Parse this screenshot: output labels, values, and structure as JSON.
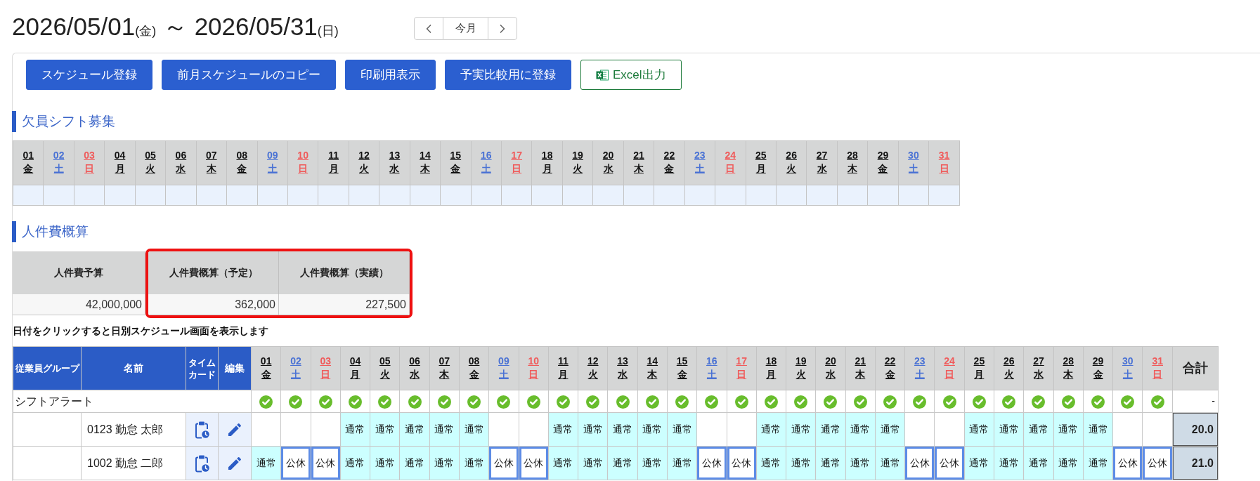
{
  "header": {
    "start_date": "2026/05/01",
    "start_weekday": "(金)",
    "separator": "～",
    "end_date": "2026/05/31",
    "end_weekday": "(日)",
    "nav": {
      "current_label": "今月"
    }
  },
  "toolbar": [
    {
      "label": "スケジュール登録",
      "kind": "primary"
    },
    {
      "label": "前月スケジュールのコピー",
      "kind": "primary"
    },
    {
      "label": "印刷用表示",
      "kind": "primary"
    },
    {
      "label": "予実比較用に登録",
      "kind": "primary"
    },
    {
      "label": "Excel出力",
      "kind": "excel"
    }
  ],
  "vacancy": {
    "heading": "欠員シフト募集",
    "days": [
      {
        "day": "01",
        "weekday": "金",
        "kind": "weekday"
      },
      {
        "day": "02",
        "weekday": "土",
        "kind": "saturday"
      },
      {
        "day": "03",
        "weekday": "日",
        "kind": "sunday"
      },
      {
        "day": "04",
        "weekday": "月",
        "kind": "weekday"
      },
      {
        "day": "05",
        "weekday": "火",
        "kind": "weekday"
      },
      {
        "day": "06",
        "weekday": "水",
        "kind": "weekday"
      },
      {
        "day": "07",
        "weekday": "木",
        "kind": "weekday"
      },
      {
        "day": "08",
        "weekday": "金",
        "kind": "weekday"
      },
      {
        "day": "09",
        "weekday": "土",
        "kind": "saturday"
      },
      {
        "day": "10",
        "weekday": "日",
        "kind": "sunday"
      },
      {
        "day": "11",
        "weekday": "月",
        "kind": "weekday"
      },
      {
        "day": "12",
        "weekday": "火",
        "kind": "weekday"
      },
      {
        "day": "13",
        "weekday": "水",
        "kind": "weekday"
      },
      {
        "day": "14",
        "weekday": "木",
        "kind": "weekday"
      },
      {
        "day": "15",
        "weekday": "金",
        "kind": "weekday"
      },
      {
        "day": "16",
        "weekday": "土",
        "kind": "saturday"
      },
      {
        "day": "17",
        "weekday": "日",
        "kind": "sunday"
      },
      {
        "day": "18",
        "weekday": "月",
        "kind": "weekday"
      },
      {
        "day": "19",
        "weekday": "火",
        "kind": "weekday"
      },
      {
        "day": "20",
        "weekday": "水",
        "kind": "weekday"
      },
      {
        "day": "21",
        "weekday": "木",
        "kind": "weekday"
      },
      {
        "day": "22",
        "weekday": "金",
        "kind": "weekday"
      },
      {
        "day": "23",
        "weekday": "土",
        "kind": "saturday"
      },
      {
        "day": "24",
        "weekday": "日",
        "kind": "sunday"
      },
      {
        "day": "25",
        "weekday": "月",
        "kind": "weekday"
      },
      {
        "day": "26",
        "weekday": "火",
        "kind": "weekday"
      },
      {
        "day": "27",
        "weekday": "水",
        "kind": "weekday"
      },
      {
        "day": "28",
        "weekday": "木",
        "kind": "weekday"
      },
      {
        "day": "29",
        "weekday": "金",
        "kind": "weekday"
      },
      {
        "day": "30",
        "weekday": "土",
        "kind": "saturday"
      },
      {
        "day": "31",
        "weekday": "日",
        "kind": "sunday"
      }
    ]
  },
  "labor_cost": {
    "heading": "人件費概算",
    "columns": [
      {
        "header": "人件費予算",
        "value": "42,000,000",
        "highlighted": false
      },
      {
        "header": "人件費概算（予定）",
        "value": "362,000",
        "highlighted": true
      },
      {
        "header": "人件費概算（実績）",
        "value": "227,500",
        "highlighted": true
      }
    ]
  },
  "note": "日付をクリックすると日別スケジュール画面を表示します",
  "schedule": {
    "columns": {
      "group": "従業員グループ",
      "name": "名前",
      "timecard": "タイムカード",
      "edit": "編集",
      "total": "合計"
    },
    "days": [
      {
        "day": "01",
        "weekday": "金",
        "kind": "weekday"
      },
      {
        "day": "02",
        "weekday": "土",
        "kind": "saturday"
      },
      {
        "day": "03",
        "weekday": "日",
        "kind": "sunday"
      },
      {
        "day": "04",
        "weekday": "月",
        "kind": "weekday"
      },
      {
        "day": "05",
        "weekday": "火",
        "kind": "weekday"
      },
      {
        "day": "06",
        "weekday": "水",
        "kind": "weekday"
      },
      {
        "day": "07",
        "weekday": "木",
        "kind": "weekday"
      },
      {
        "day": "08",
        "weekday": "金",
        "kind": "weekday"
      },
      {
        "day": "09",
        "weekday": "土",
        "kind": "saturday"
      },
      {
        "day": "10",
        "weekday": "日",
        "kind": "sunday"
      },
      {
        "day": "11",
        "weekday": "月",
        "kind": "weekday"
      },
      {
        "day": "12",
        "weekday": "火",
        "kind": "weekday"
      },
      {
        "day": "13",
        "weekday": "水",
        "kind": "weekday"
      },
      {
        "day": "14",
        "weekday": "木",
        "kind": "weekday"
      },
      {
        "day": "15",
        "weekday": "金",
        "kind": "weekday"
      },
      {
        "day": "16",
        "weekday": "土",
        "kind": "saturday"
      },
      {
        "day": "17",
        "weekday": "日",
        "kind": "sunday"
      },
      {
        "day": "18",
        "weekday": "月",
        "kind": "weekday"
      },
      {
        "day": "19",
        "weekday": "火",
        "kind": "weekday"
      },
      {
        "day": "20",
        "weekday": "水",
        "kind": "weekday"
      },
      {
        "day": "21",
        "weekday": "木",
        "kind": "weekday"
      },
      {
        "day": "22",
        "weekday": "金",
        "kind": "weekday"
      },
      {
        "day": "23",
        "weekday": "土",
        "kind": "saturday"
      },
      {
        "day": "24",
        "weekday": "日",
        "kind": "sunday"
      },
      {
        "day": "25",
        "weekday": "月",
        "kind": "weekday"
      },
      {
        "day": "26",
        "weekday": "火",
        "kind": "weekday"
      },
      {
        "day": "27",
        "weekday": "水",
        "kind": "weekday"
      },
      {
        "day": "28",
        "weekday": "木",
        "kind": "weekday"
      },
      {
        "day": "29",
        "weekday": "金",
        "kind": "weekday"
      },
      {
        "day": "30",
        "weekday": "土",
        "kind": "saturday"
      },
      {
        "day": "31",
        "weekday": "日",
        "kind": "sunday"
      }
    ],
    "alert": {
      "label": "シフトアラート",
      "days": [
        {
          "ok": true
        },
        {
          "ok": true
        },
        {
          "ok": true
        },
        {
          "ok": true
        },
        {
          "ok": true
        },
        {
          "ok": true
        },
        {
          "ok": true
        },
        {
          "ok": true
        },
        {
          "ok": true
        },
        {
          "ok": true
        },
        {
          "ok": true
        },
        {
          "ok": true
        },
        {
          "ok": true
        },
        {
          "ok": true
        },
        {
          "ok": true
        },
        {
          "ok": true
        },
        {
          "ok": true
        },
        {
          "ok": true
        },
        {
          "ok": true
        },
        {
          "ok": true
        },
        {
          "ok": true
        },
        {
          "ok": true
        },
        {
          "ok": true
        },
        {
          "ok": true
        },
        {
          "ok": true
        },
        {
          "ok": true
        },
        {
          "ok": true
        },
        {
          "ok": true
        },
        {
          "ok": true
        },
        {
          "ok": true
        },
        {
          "ok": true
        }
      ],
      "total": "-"
    },
    "employees": [
      {
        "name": "0123 勤怠 太郎",
        "total": "20.0",
        "shifts": [
          {
            "kind": "blank"
          },
          {
            "kind": "blank"
          },
          {
            "kind": "blank"
          },
          {
            "kind": "work",
            "label": "通常"
          },
          {
            "kind": "work",
            "label": "通常"
          },
          {
            "kind": "work",
            "label": "通常"
          },
          {
            "kind": "work",
            "label": "通常"
          },
          {
            "kind": "work",
            "label": "通常"
          },
          {
            "kind": "blank"
          },
          {
            "kind": "blank"
          },
          {
            "kind": "work",
            "label": "通常"
          },
          {
            "kind": "work",
            "label": "通常"
          },
          {
            "kind": "work",
            "label": "通常"
          },
          {
            "kind": "work",
            "label": "通常"
          },
          {
            "kind": "work",
            "label": "通常"
          },
          {
            "kind": "blank"
          },
          {
            "kind": "blank"
          },
          {
            "kind": "work",
            "label": "通常"
          },
          {
            "kind": "work",
            "label": "通常"
          },
          {
            "kind": "work",
            "label": "通常"
          },
          {
            "kind": "work",
            "label": "通常"
          },
          {
            "kind": "work",
            "label": "通常"
          },
          {
            "kind": "blank"
          },
          {
            "kind": "blank"
          },
          {
            "kind": "work",
            "label": "通常"
          },
          {
            "kind": "work",
            "label": "通常"
          },
          {
            "kind": "work",
            "label": "通常"
          },
          {
            "kind": "work",
            "label": "通常"
          },
          {
            "kind": "work",
            "label": "通常"
          },
          {
            "kind": "blank"
          },
          {
            "kind": "blank"
          }
        ]
      },
      {
        "name": "1002 勤怠 二郎",
        "total": "21.0",
        "shifts": [
          {
            "kind": "work",
            "label": "通常"
          },
          {
            "kind": "holiday",
            "label": "公休"
          },
          {
            "kind": "holiday",
            "label": "公休"
          },
          {
            "kind": "work",
            "label": "通常"
          },
          {
            "kind": "work",
            "label": "通常"
          },
          {
            "kind": "work",
            "label": "通常"
          },
          {
            "kind": "work",
            "label": "通常"
          },
          {
            "kind": "work",
            "label": "通常"
          },
          {
            "kind": "holiday",
            "label": "公休"
          },
          {
            "kind": "holiday",
            "label": "公休"
          },
          {
            "kind": "work",
            "label": "通常"
          },
          {
            "kind": "work",
            "label": "通常"
          },
          {
            "kind": "work",
            "label": "通常"
          },
          {
            "kind": "work",
            "label": "通常"
          },
          {
            "kind": "work",
            "label": "通常"
          },
          {
            "kind": "holiday",
            "label": "公休"
          },
          {
            "kind": "holiday",
            "label": "公休"
          },
          {
            "kind": "work",
            "label": "通常"
          },
          {
            "kind": "work",
            "label": "通常"
          },
          {
            "kind": "work",
            "label": "通常"
          },
          {
            "kind": "work",
            "label": "通常"
          },
          {
            "kind": "work",
            "label": "通常"
          },
          {
            "kind": "holiday",
            "label": "公休"
          },
          {
            "kind": "holiday",
            "label": "公休"
          },
          {
            "kind": "work",
            "label": "通常"
          },
          {
            "kind": "work",
            "label": "通常"
          },
          {
            "kind": "work",
            "label": "通常"
          },
          {
            "kind": "work",
            "label": "通常"
          },
          {
            "kind": "work",
            "label": "通常"
          },
          {
            "kind": "holiday",
            "label": "公休"
          },
          {
            "kind": "holiday",
            "label": "公休"
          }
        ]
      }
    ]
  }
}
